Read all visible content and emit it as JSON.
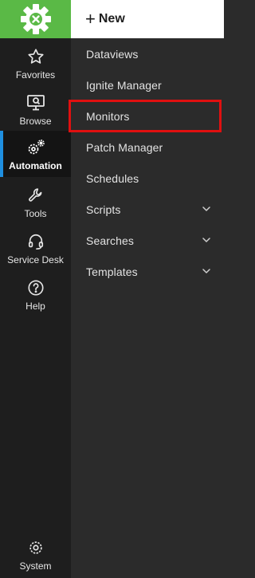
{
  "toolbar": {
    "new_label": "New"
  },
  "rail": {
    "items": [
      {
        "label": "Favorites",
        "icon": "star-icon"
      },
      {
        "label": "Browse",
        "icon": "monitor-search-icon"
      },
      {
        "label": "Automation",
        "icon": "gears-icon",
        "active": true
      },
      {
        "label": "Tools",
        "icon": "wrench-icon"
      },
      {
        "label": "Service Desk",
        "icon": "headset-icon"
      },
      {
        "label": "Help",
        "icon": "question-icon"
      }
    ],
    "system_label": "System"
  },
  "menu": {
    "items": [
      {
        "label": "Dataviews",
        "has_submenu": false
      },
      {
        "label": "Ignite Manager",
        "has_submenu": false
      },
      {
        "label": "Monitors",
        "has_submenu": false,
        "highlighted": true
      },
      {
        "label": "Patch Manager",
        "has_submenu": false
      },
      {
        "label": "Schedules",
        "has_submenu": false
      },
      {
        "label": "Scripts",
        "has_submenu": true
      },
      {
        "label": "Searches",
        "has_submenu": true
      },
      {
        "label": "Templates",
        "has_submenu": true
      }
    ]
  },
  "colors": {
    "brand_green": "#5ab946",
    "active_accent": "#1f8fe0",
    "highlight_red": "#e01010"
  }
}
